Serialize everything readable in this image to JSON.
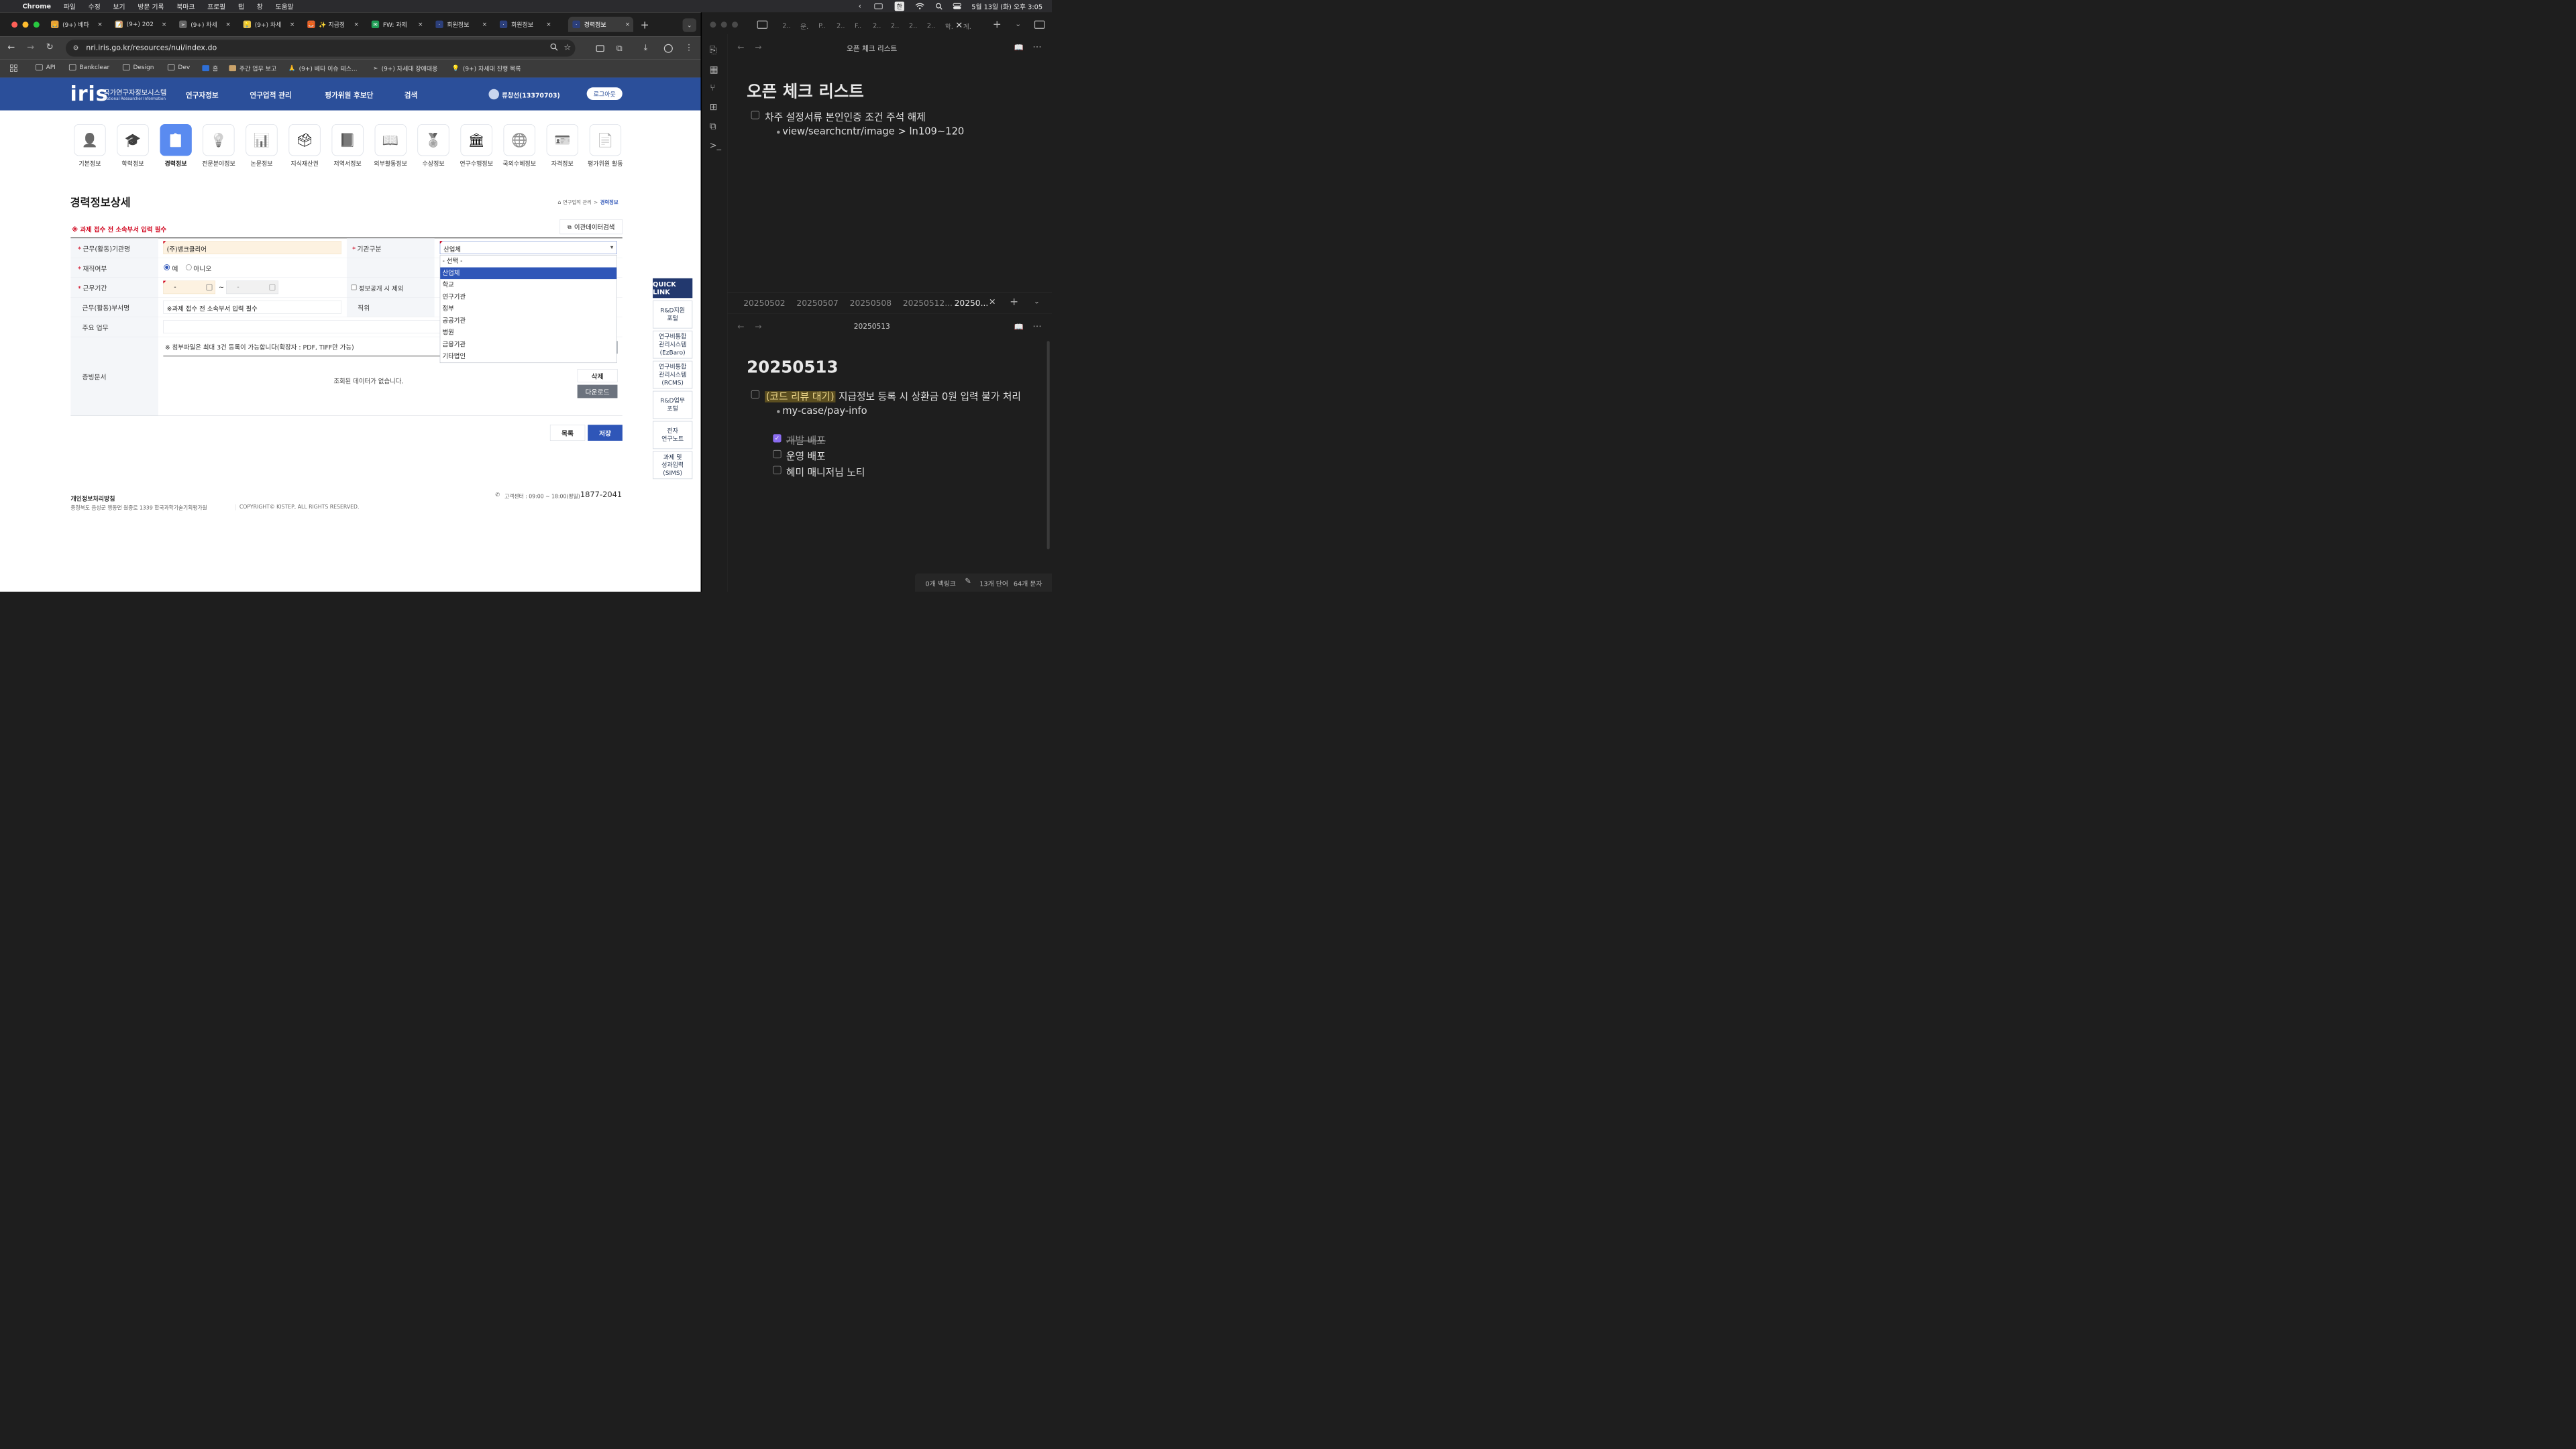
{
  "menubar": {
    "app": "Chrome",
    "menus": [
      "파일",
      "수정",
      "보기",
      "방문 기록",
      "북마크",
      "프로필",
      "탭",
      "창",
      "도움말"
    ],
    "input_method": "한",
    "datetime": "5월 13일 (화) 오후 3:05"
  },
  "browser": {
    "tabs": [
      {
        "title": "(9+) 베타",
        "color": "#e7a23a",
        "glyph": "🙏"
      },
      {
        "title": "(9+) 202",
        "color": "#c9a26a",
        "glyph": "📝"
      },
      {
        "title": "(9+) 차세",
        "color": "#666666",
        "glyph": "➢"
      },
      {
        "title": "(9+) 차세",
        "color": "#e7c34a",
        "glyph": "💡"
      },
      {
        "title": "✨ 지급정",
        "color": "#e8622b",
        "glyph": "🦊"
      },
      {
        "title": "FW: 과제",
        "color": "#1f9d55",
        "glyph": "✉"
      },
      {
        "title": "회원정보",
        "color": "#2c3f7a",
        "glyph": "·"
      },
      {
        "title": "회원정보",
        "color": "#2c3f7a",
        "glyph": "·"
      },
      {
        "title": "경력정보",
        "color": "#2c3f7a",
        "glyph": "·"
      }
    ],
    "url": "nri.iris.go.kr/resources/nui/index.do",
    "bookmarks": [
      "API",
      "Bankclear",
      "Design",
      "Dev",
      "홈",
      "주간 업무 보고",
      "(9+) 베타 이슈 테스...",
      "(9+) 차세대 장애대응",
      "(9+) 차세대 진행 목록"
    ]
  },
  "site": {
    "logo": "iris",
    "logo_title": "국가연구자정보시스템",
    "logo_subtitle": "National Researcher Information",
    "nav": [
      "연구자정보",
      "연구업적 관리",
      "평가위원 후보단",
      "검색"
    ],
    "user": "류창선(13370703)",
    "logout": "로그아웃",
    "menu": [
      {
        "label": "기본정보",
        "icon": "person-icon"
      },
      {
        "label": "학력정보",
        "icon": "graduation-cap-icon"
      },
      {
        "label": "경력정보",
        "icon": "clipboard-icon"
      },
      {
        "label": "전문분야정보",
        "icon": "lightbulb-icon"
      },
      {
        "label": "논문정보",
        "icon": "document-chart-icon"
      },
      {
        "label": "지식재산권",
        "icon": "stamp-icon"
      },
      {
        "label": "저역서정보",
        "icon": "book-icon"
      },
      {
        "label": "외부활동정보",
        "icon": "open-book-icon"
      },
      {
        "label": "수상정보",
        "icon": "medal-icon"
      },
      {
        "label": "연구수행정보",
        "icon": "institution-icon"
      },
      {
        "label": "국외수혜정보",
        "icon": "globe-icon"
      },
      {
        "label": "자격정보",
        "icon": "id-card-icon"
      },
      {
        "label": "평가위원 활동",
        "icon": "list-icon"
      }
    ],
    "page_title": "경력정보상세",
    "breadcrumb": [
      "연구업적 관리",
      "경력정보"
    ],
    "notice": "※ 과제 접수 전 소속부서 입력 필수",
    "transfer_search": "이관데이터검색"
  },
  "form": {
    "org_label": "근무(활동)기관명",
    "org_value": "(주)뱅크클리어",
    "type_label": "기관구분",
    "type_value": "산업체",
    "type_options": [
      "- 선택 -",
      "산업체",
      "학교",
      "연구기관",
      "정부",
      "공공기관",
      "병원",
      "금융기관",
      "기타법인"
    ],
    "employed_label": "재직여부",
    "yes": "예",
    "no": "아니오",
    "period_label": "근무기간",
    "date_start": "-",
    "date_sep": "~",
    "date_end": "-",
    "disclosure": "정보공개 시 제외",
    "dept_label": "근무(활동)부서명",
    "dept_value": "※과제 접수 전 소속부서 입력 필수",
    "position_label": "직위",
    "duty_label": "주요 업무",
    "doc_label": "증빙문서",
    "attach_note": "※ 첨부파일은 최대 3건 등록이 가능합니다(확장자 : PDF, TIFF만 가능)",
    "no_data": "조회된 데이터가 없습니다.",
    "delete": "삭제",
    "download": "다운로드",
    "list": "목록",
    "save": "저장"
  },
  "quicklink": {
    "title": "QUICK LINK",
    "items": [
      "R&D지원\n포털",
      "연구비통합\n관리시스템\n(EzBaro)",
      "연구비통합\n관리시스템\n(RCMS)",
      "R&D업무\n포털",
      "전자\n연구노트",
      "과제 및\n성과입력\n(SIMS)"
    ]
  },
  "footer": {
    "privacy": "개인정보처리방침",
    "address": "충청북도 음성군 맹동면 원중로 1339 한국과학기술기획평가원",
    "copyright": "COPYRIGHT© KISTEP, ALL RIGHTS RESERVED.",
    "hours": "고객센터 : 09:00 ~ 18:00(평일)",
    "phone": "1877-2041"
  },
  "obsidian": {
    "top_tabs": [
      "2..",
      "운.",
      "P..",
      "2..",
      "F..",
      "2..",
      "2..",
      "2..",
      "2..",
      "학.",
      "계."
    ],
    "top_title": "오픈 체크 리스트",
    "heading1": "오픈 체크 리스트",
    "item1": "차주 설정서류 본인인증 조건 주석 해제",
    "item1_sub": "view/searchcntr/image > ln109~120",
    "bottom_tabs": [
      "20250502",
      "20250507",
      "20250508",
      "20250512...",
      "20250..."
    ],
    "bottom_title": "20250513",
    "heading2": "20250513",
    "task_tag": "(코드 리뷰 대기)",
    "task_text": "지급정보 등록 시 상환금 0원 입력 불가 처리",
    "task_sub": "my-case/pay-info",
    "sub_tasks": [
      {
        "text": "개발 배포",
        "done": true
      },
      {
        "text": "운영 배포",
        "done": false
      },
      {
        "text": "혜미 매니저님 노티",
        "done": false
      }
    ],
    "status_backlinks": "0개 백링크",
    "status_words": "13개 단어",
    "status_chars": "64개 문자"
  }
}
